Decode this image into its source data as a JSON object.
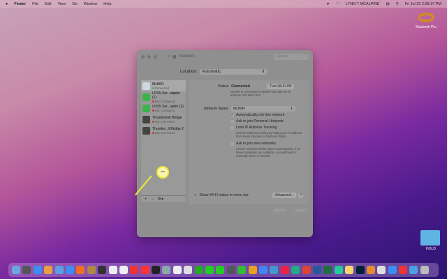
{
  "menubar": {
    "apple": "",
    "items": [
      "Finder",
      "File",
      "Edit",
      "View",
      "Go",
      "Window",
      "Help"
    ],
    "user": "LYNN T MCALPINE",
    "datetime": "Fri Jul 22  2:58:37 PM"
  },
  "desktop": {
    "drive": "Macbook Pro",
    "folder": "HOLD"
  },
  "window": {
    "title": "Network",
    "search_placeholder": "Search",
    "location_label": "Location:",
    "location_value": "Automatic",
    "services": [
      {
        "name": "McWiFi",
        "status": "Connected",
        "color": "#3bb54a",
        "icon": "wifi-icon",
        "iconbg": "#cfd7e0"
      },
      {
        "name": "LPSS Ser...dapter (1)",
        "status": "Not Configured",
        "color": "#d9302c",
        "icon": "phone-icon",
        "iconbg": "#3cb44b"
      },
      {
        "name": "LPSS Ser...apter (2)",
        "status": "Not Configured",
        "color": "#d9302c",
        "icon": "phone-icon",
        "iconbg": "#3cb44b"
      },
      {
        "name": "Thunderbolt Bridge",
        "status": "Not Connected",
        "color": "#d9302c",
        "icon": "thunderbolt-icon",
        "iconbg": "#444"
      },
      {
        "name": "Thunder...lt Bridge 2",
        "status": "Not Connected",
        "color": "#d9302c",
        "icon": "thunderbolt-icon",
        "iconbg": "#444"
      }
    ],
    "status_label": "Status:",
    "status_value": "Connected",
    "turn_off": "Turn Wi-Fi Off",
    "status_desc": "McWiFi is connected to McWiFi and has the IP address 192.168.0.237.",
    "network_name_label": "Network Name:",
    "network_name": "McWiFi",
    "auto_join": "Automatically join this network",
    "hotspots": "Ask to join Personal Hotspots",
    "limit_ip": "Limit IP Address Tracking",
    "limit_ip_desc": "Limit IP address tracking by hiding your IP address from known trackers in Mail and Safari.",
    "ask_new": "Ask to join new networks",
    "ask_new_desc": "Known networks will be joined automatically. If no known networks are available, you will have to manually select a network.",
    "show_status": "Show Wi-Fi status in menu bar",
    "advanced": "Advanced...",
    "help": "?",
    "revert": "Revert",
    "apply": "Apply",
    "add": "+",
    "remove": "−",
    "action": "⚙▾",
    "callout": "−"
  },
  "dock_colors": [
    "#6aa7e0",
    "#555",
    "#3a8ff0",
    "#e8a040",
    "#5aa0e0",
    "#3a8ff0",
    "#f07020",
    "#b08a40",
    "#333",
    "#eee",
    "#eee",
    "#e33",
    "#f33",
    "#222",
    "#8aa",
    "#eee",
    "#ddd",
    "#2a2",
    "#2c2",
    "#2c2",
    "#555",
    "#3b3",
    "#e9a020",
    "#4285f4",
    "#49c",
    "#e24",
    "#2a8",
    "#d43",
    "#2b579a",
    "#1d6f42",
    "#2c9",
    "#f6d66a",
    "#001e36",
    "#e88a30",
    "#ddd",
    "#3a8ff0",
    "#e33",
    "#4aa0e0",
    "#bbb"
  ]
}
